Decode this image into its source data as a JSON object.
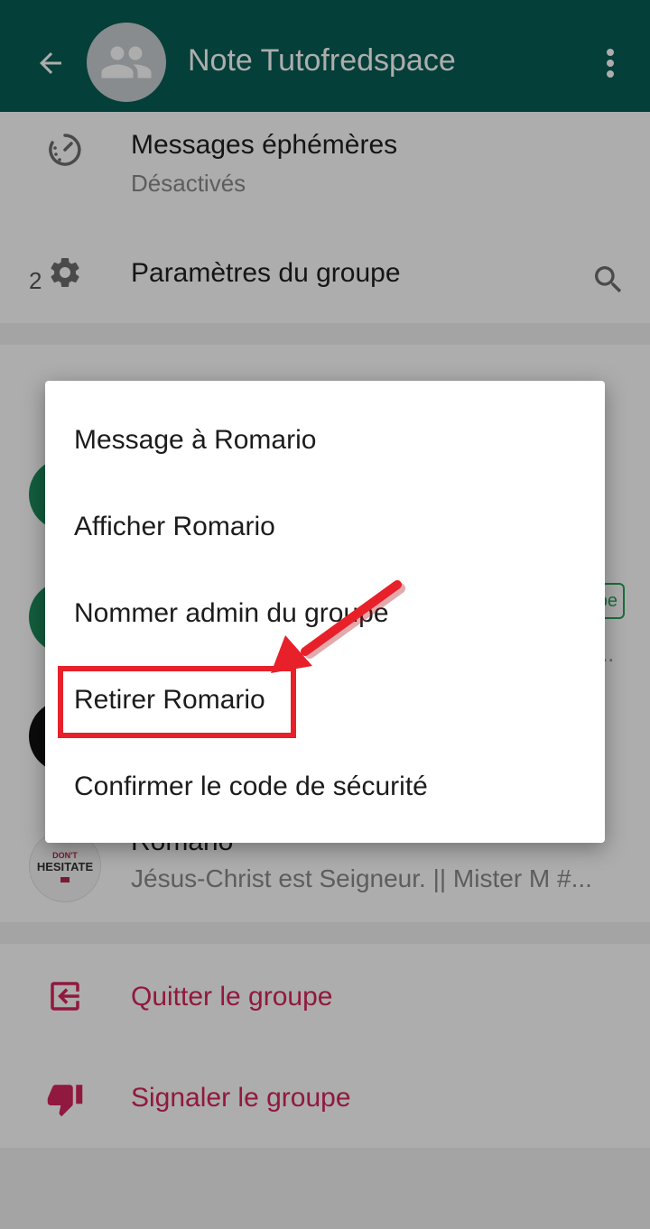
{
  "header": {
    "title": "Note Tutofredspace",
    "color": "#075e54"
  },
  "settings": {
    "ephemeral_label": "Messages éphémères",
    "ephemeral_value": "Désactivés",
    "group_settings_label": "Paramètres du groupe"
  },
  "participants": {
    "count_prefix": "2",
    "members": [
      {
        "name": "Romario",
        "status": "Jésus-Christ est Seigneur. || Mister M #..."
      }
    ],
    "admin_badge_partial": "pe",
    "status_ellipsis": "..."
  },
  "actions": {
    "exit_label": "Quitter le groupe",
    "report_label": "Signaler le groupe",
    "danger_color": "#d6245c"
  },
  "context_menu": {
    "items": [
      "Message à Romario",
      "Afficher Romario",
      "Nommer admin du groupe",
      "Retirer Romario",
      "Confirmer le code de sécurité"
    ]
  },
  "avatar_logo_text": {
    "line1": "DON'T",
    "line2": "HESITATE"
  },
  "annotation": {
    "highlight_color": "#e8202a",
    "target_item": "Retirer Romario"
  }
}
